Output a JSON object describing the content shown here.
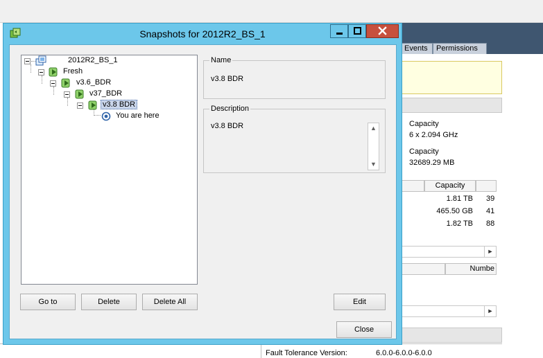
{
  "dialog": {
    "title": "Snapshots for  2012R2_BS_1",
    "name_group_label": "Name",
    "name_value": "v3.8 BDR",
    "description_group_label": "Description",
    "description_value": "v3.8 BDR",
    "buttons": {
      "goto": "Go to",
      "delete": "Delete",
      "delete_all": "Delete All",
      "edit": "Edit",
      "close": "Close"
    },
    "tree": {
      "root": "2012R2_BS_1",
      "nodes": [
        "Fresh",
        "v3.6_BDR",
        "v37_BDR",
        "v3.8 BDR"
      ],
      "current": "You are here"
    }
  },
  "background": {
    "tabs": {
      "events": "Events",
      "permissions": "Permissions"
    },
    "capacity_label_1": "Capacity",
    "cpu_value": "6 x 2.094 GHz",
    "capacity_label_2": "Capacity",
    "memory_value": "32689.29 MB",
    "storage_header": "Capacity",
    "storage_rows": [
      "1.81 TB",
      "465.50 GB",
      "1.82 TB"
    ],
    "storage_col2": [
      "39",
      "41",
      "88"
    ],
    "network_header": "Numbe",
    "fault_tolerance_label": "Fault Tolerance Version:",
    "fault_tolerance_value": "6.0.0-6.0.0-6.0.0"
  },
  "colors": {
    "dialog_frame": "#6cc7ea",
    "close_button": "#c7503d",
    "background_navy": "#3f5670"
  }
}
